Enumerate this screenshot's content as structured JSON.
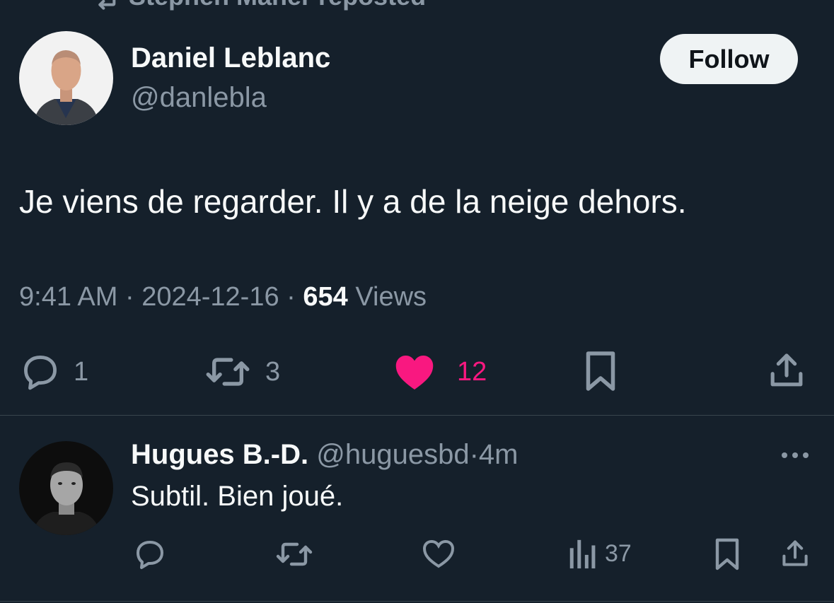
{
  "repost_banner": {
    "text": "Stephen Maher reposted",
    "icon": "repost-icon"
  },
  "tweet": {
    "author_name": "Daniel Leblanc",
    "author_handle": "@danlebla",
    "follow_label": "Follow",
    "text": "Je viens de regarder. Il y a de la neige dehors.",
    "time": "9:41 AM",
    "date": "2024-12-16",
    "separator": "·",
    "views_count": "654",
    "views_label": "Views",
    "actions": {
      "reply_count": "1",
      "repost_count": "3",
      "like_count": "12",
      "liked": true
    }
  },
  "reply": {
    "author_name": "Hugues B.-D.",
    "author_handle": "@huguesbd",
    "separator": "·",
    "time": "4m",
    "text": "Subtil. Bien joué.",
    "views_count": "37"
  },
  "colors": {
    "background": "#15202b",
    "primary_text": "#f7f9f9",
    "secondary_text": "#8b98a5",
    "like_pink": "#f91880",
    "divider": "#38444d",
    "follow_bg": "#eff3f4"
  }
}
